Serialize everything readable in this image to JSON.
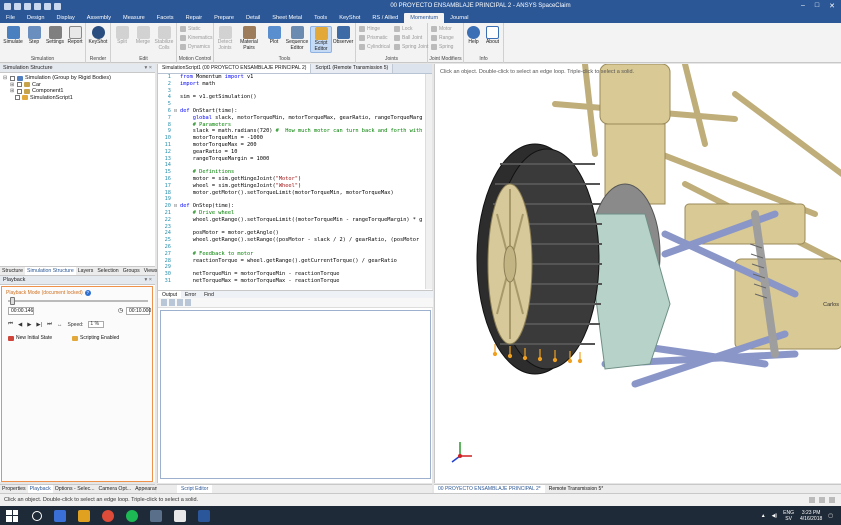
{
  "window": {
    "title": "00 PROYECTO ENSAMBLAJE PRINCIPAL 2 - ANSYS SpaceClaim"
  },
  "ribbon_tabs": [
    "File",
    "Design",
    "Display",
    "Assembly",
    "Measure",
    "Facets",
    "Repair",
    "Prepare",
    "Detail",
    "Sheet Metal",
    "Tools",
    "KeyShot",
    "RS / Allied",
    "Momentum",
    "Journal"
  ],
  "active_tab": "Momentum",
  "ribbon": {
    "groups": [
      {
        "name": "Simulation",
        "buttons": [
          "Simulate",
          "Step",
          "Settings",
          "Report"
        ]
      },
      {
        "name": "Render",
        "buttons": [
          "KeyShot"
        ]
      },
      {
        "name": "Edit",
        "buttons": [
          "Split",
          "Merge",
          "Stabilize Colls"
        ]
      },
      {
        "name": "Motion Control",
        "items": [
          "Static",
          "Kinematics",
          "Dynamics"
        ]
      },
      {
        "name": "Tools",
        "buttons": [
          "Detect Joints",
          "Material Pairs",
          "Plot",
          "Sequence Editor",
          "Script Editor",
          "Observer"
        ]
      },
      {
        "name": "Joints",
        "items": [
          "Hinge",
          "Prismatic",
          "Cylindrical",
          "Lock",
          "Ball Joint",
          "Spring Joint"
        ]
      },
      {
        "name": "Joint Modifiers",
        "items": [
          "Motor",
          "Range",
          "Spring"
        ]
      },
      {
        "name": "Info",
        "buttons": [
          "Help",
          "About"
        ]
      }
    ]
  },
  "simulation_structure": {
    "title": "Simulation Structure",
    "nodes": [
      {
        "label": "Simulation (Group by Rigid Bodies)",
        "level": 0
      },
      {
        "label": "Car",
        "level": 1
      },
      {
        "label": "Component1",
        "level": 1
      },
      {
        "label": "SimulationScript1",
        "level": 1
      }
    ]
  },
  "left_tabs": [
    "Structure",
    "Simulation Structure",
    "Layers",
    "Selection",
    "Groups",
    "Views"
  ],
  "playback": {
    "title": "Playback",
    "mode_label": "Playback Mode (document locked)",
    "current_time": "00:00.146",
    "end_time": "00:10.000",
    "speed_label": "Speed:",
    "speed_value": "1 %",
    "new_initial_state": "New Initial State",
    "scripting_enabled": "Scripting Enabled",
    "progress": 0.015
  },
  "left_bottom_tabs": [
    "Properties",
    "Playback",
    "Options - Selec...",
    "Camera Opt...",
    "Appearance"
  ],
  "script_tabs": [
    "SimulationScript1 (00 PROYECTO ENSAMBLAJE PRINCIPAL 2)",
    "Script1 (Remote Transmission 5)"
  ],
  "code_lines": [
    {
      "n": "1",
      "segs": [
        [
          "kw",
          "from"
        ],
        [
          "t",
          " Momentum "
        ],
        [
          "kw",
          "import"
        ],
        [
          "t",
          " v1"
        ]
      ]
    },
    {
      "n": "2",
      "segs": [
        [
          "kw",
          "import"
        ],
        [
          "t",
          " math"
        ]
      ]
    },
    {
      "n": "3",
      "segs": [
        [
          "t",
          ""
        ]
      ]
    },
    {
      "n": "4",
      "segs": [
        [
          "t",
          "sim = v1.getSimulation()"
        ]
      ]
    },
    {
      "n": "5",
      "segs": [
        [
          "t",
          ""
        ]
      ]
    },
    {
      "n": "6",
      "segs": [
        [
          "kw",
          "def"
        ],
        [
          "t",
          " OnStart(time):"
        ]
      ]
    },
    {
      "n": "7",
      "segs": [
        [
          "t",
          "    "
        ],
        [
          "kw",
          "global"
        ],
        [
          "t",
          " slack, motorTorqueMin, motorTorqueMax, gearRatio, rangeTorqueMarg"
        ]
      ]
    },
    {
      "n": "8",
      "segs": [
        [
          "cm",
          "    # Parameters"
        ]
      ]
    },
    {
      "n": "9",
      "segs": [
        [
          "t",
          "    slack = math.radians(720) "
        ],
        [
          "cm",
          "#  How much motor can turn back and forth with"
        ]
      ]
    },
    {
      "n": "10",
      "segs": [
        [
          "t",
          "    motorTorqueMin = -1000"
        ]
      ]
    },
    {
      "n": "11",
      "segs": [
        [
          "t",
          "    motorTorqueMax = 200"
        ]
      ]
    },
    {
      "n": "12",
      "segs": [
        [
          "t",
          "    gearRatio = 10"
        ]
      ]
    },
    {
      "n": "13",
      "segs": [
        [
          "t",
          "    rangeTorqueMargin = 1000"
        ]
      ]
    },
    {
      "n": "14",
      "segs": [
        [
          "t",
          ""
        ]
      ]
    },
    {
      "n": "15",
      "segs": [
        [
          "cm",
          "    # Definitions"
        ]
      ]
    },
    {
      "n": "16",
      "segs": [
        [
          "t",
          "    motor = sim.getHingeJoint("
        ],
        [
          "st",
          "\"Motor\""
        ],
        [
          "t",
          ")"
        ]
      ]
    },
    {
      "n": "17",
      "segs": [
        [
          "t",
          "    wheel = sim.getHingeJoint("
        ],
        [
          "st",
          "\"Wheel\""
        ],
        [
          "t",
          ")"
        ]
      ]
    },
    {
      "n": "18",
      "segs": [
        [
          "t",
          "    motor.getMotor().setTorqueLimit(motorTorqueMin, motorTorqueMax)"
        ]
      ]
    },
    {
      "n": "19",
      "segs": [
        [
          "t",
          ""
        ]
      ]
    },
    {
      "n": "20",
      "segs": [
        [
          "kw",
          "def"
        ],
        [
          "t",
          " OnStep(time):"
        ]
      ]
    },
    {
      "n": "21",
      "segs": [
        [
          "cm",
          "    # Drive wheel"
        ]
      ]
    },
    {
      "n": "22",
      "segs": [
        [
          "t",
          "    wheel.getRange().setTorqueLimit((motorTorqueMin - rangeTorqueMargin) * g"
        ]
      ]
    },
    {
      "n": "23",
      "segs": [
        [
          "t",
          ""
        ]
      ]
    },
    {
      "n": "24",
      "segs": [
        [
          "t",
          "    posMotor = motor.getAngle()"
        ]
      ]
    },
    {
      "n": "25",
      "segs": [
        [
          "t",
          "    wheel.getRange().setRange((posMotor - slack / 2) / gearRatio, (posMotor"
        ]
      ]
    },
    {
      "n": "26",
      "segs": [
        [
          "t",
          ""
        ]
      ]
    },
    {
      "n": "27",
      "segs": [
        [
          "cm",
          "    # Feedback to motor"
        ]
      ]
    },
    {
      "n": "28",
      "segs": [
        [
          "t",
          "    reactionTorque = wheel.getRange().getCurrentTorque() / gearRatio"
        ]
      ]
    },
    {
      "n": "29",
      "segs": [
        [
          "t",
          ""
        ]
      ]
    },
    {
      "n": "30",
      "segs": [
        [
          "t",
          "    netTorqueMin = motorTorqueMin - reactionTorque"
        ]
      ]
    },
    {
      "n": "31",
      "segs": [
        [
          "t",
          "    netTorqueMax = motorTorqueMax - reactionTorque"
        ]
      ]
    }
  ],
  "output_tabs": [
    "Output",
    "Error",
    "Find"
  ],
  "script_bottom_tab": "Script Editor",
  "viewport": {
    "hint": "Click an object. Double-click to select an edge loop. Triple-click to select a solid.",
    "label_fragment": "Carlos"
  },
  "viewport_tabs": [
    "00 PROYECTO ENSAMBLAJE PRINCIPAL 2*",
    "Remote Transmission 5*"
  ],
  "status_text": "Click an object. Double-click to select an edge loop. Triple-click to select a solid.",
  "taskbar": {
    "lang": "ENG",
    "region": "SV",
    "time": "3:23 PM",
    "date": "4/16/2018"
  }
}
